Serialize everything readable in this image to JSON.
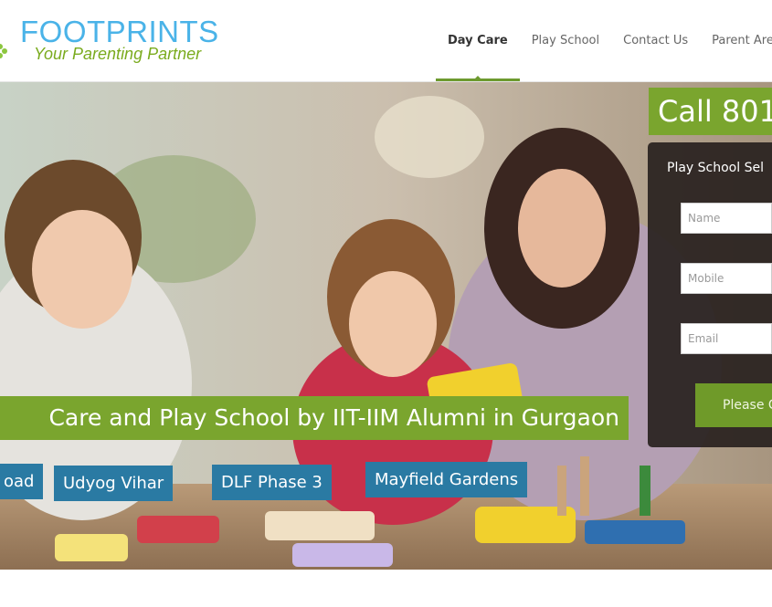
{
  "brand": {
    "name": "FOOTPRINTS",
    "tagline": "Your Parenting Partner",
    "title_color": "#4ab3e8",
    "tagline_color": "#7aab1e"
  },
  "nav": {
    "items": [
      {
        "label": "Day Care",
        "active": true
      },
      {
        "label": "Play School",
        "active": false
      },
      {
        "label": "Contact Us",
        "active": false
      },
      {
        "label": "Parent Area",
        "active": false
      }
    ]
  },
  "hero": {
    "call_text": "Call 801",
    "banner_text": "Care and Play School by IIT-IIM Alumni in Gurgaon",
    "locations": [
      "oad",
      "Udyog Vihar",
      "DLF Phase 3",
      "Mayfield Gardens"
    ],
    "accent_green": "#7aa52e",
    "location_blue": "#2a7aa3"
  },
  "form": {
    "title": "Play School Sel",
    "name_placeholder": "Name",
    "mobile_placeholder": "Mobile",
    "email_placeholder": "Email",
    "submit_label": "Please C"
  }
}
